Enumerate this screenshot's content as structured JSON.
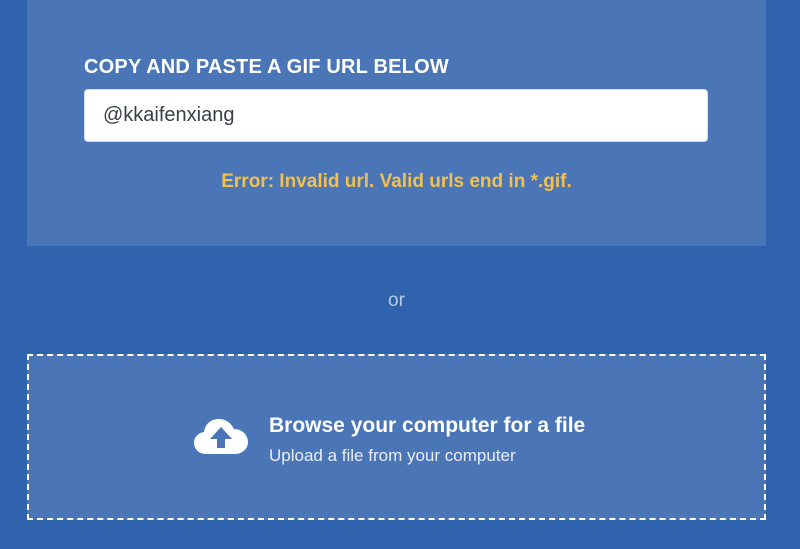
{
  "url_section": {
    "label": "COPY AND PASTE A GIF URL BELOW",
    "input_value": "@kkaifenxiang",
    "error": "Error: Invalid url. Valid urls end in *.gif."
  },
  "separator": "or",
  "upload": {
    "title": "Browse your computer for a file",
    "subtitle": "Upload a file from your computer",
    "icon": "cloud-upload-icon"
  },
  "colors": {
    "background": "#3063ae",
    "panel": "#4a75b7",
    "error": "#f3c04d"
  }
}
